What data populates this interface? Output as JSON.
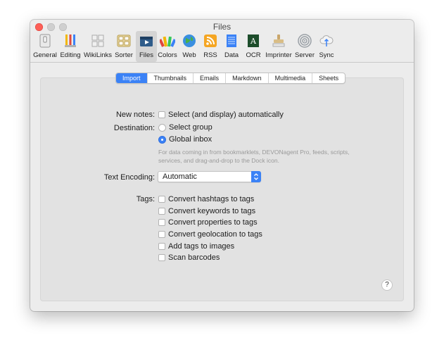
{
  "window": {
    "title": "Files"
  },
  "toolbar": {
    "items": [
      {
        "label": "General",
        "icon": "switch-icon"
      },
      {
        "label": "Editing",
        "icon": "pencils-icon"
      },
      {
        "label": "WikiLinks",
        "icon": "puzzle-icon"
      },
      {
        "label": "Sorter",
        "icon": "sorter-icon"
      },
      {
        "label": "Files",
        "icon": "files-icon",
        "selected": true
      },
      {
        "label": "Colors",
        "icon": "color-wheel-icon"
      },
      {
        "label": "Web",
        "icon": "globe-icon"
      },
      {
        "label": "RSS",
        "icon": "rss-icon"
      },
      {
        "label": "Data",
        "icon": "data-icon"
      },
      {
        "label": "OCR",
        "icon": "ocr-icon"
      },
      {
        "label": "Imprinter",
        "icon": "stamp-icon"
      },
      {
        "label": "Server",
        "icon": "server-icon"
      },
      {
        "label": "Sync",
        "icon": "cloud-sync-icon"
      }
    ]
  },
  "tabs": [
    {
      "label": "Import",
      "active": true
    },
    {
      "label": "Thumbnails"
    },
    {
      "label": "Emails"
    },
    {
      "label": "Markdown"
    },
    {
      "label": "Multimedia"
    },
    {
      "label": "Sheets"
    }
  ],
  "form": {
    "new_notes": {
      "label": "New notes:",
      "option": "Select (and display) automatically",
      "checked": false
    },
    "destination": {
      "label": "Destination:",
      "options": [
        {
          "label": "Select group",
          "selected": false
        },
        {
          "label": "Global inbox",
          "selected": true
        }
      ],
      "hint": "For data coming in from bookmarklets, DEVONagent Pro, feeds, scripts, services, and drag-and-drop to the Dock icon."
    },
    "text_encoding": {
      "label": "Text Encoding:",
      "value": "Automatic"
    },
    "tags": {
      "label": "Tags:",
      "options": [
        {
          "label": "Convert hashtags to tags",
          "checked": false
        },
        {
          "label": "Convert keywords to tags",
          "checked": false
        },
        {
          "label": "Convert properties to tags",
          "checked": false
        },
        {
          "label": "Convert geolocation to tags",
          "checked": false
        },
        {
          "label": "Add tags to images",
          "checked": false
        },
        {
          "label": "Scan barcodes",
          "checked": false
        }
      ]
    }
  },
  "help": {
    "label": "?"
  },
  "colors": {
    "accent": "#3b82f6",
    "close": "#fd5f57"
  }
}
